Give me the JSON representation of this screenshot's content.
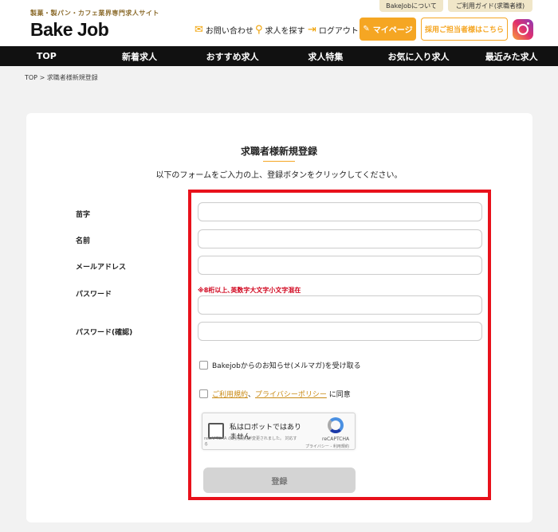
{
  "header": {
    "about_label": "BakeJobについて",
    "guide_label": "ご利用ガイド(求職者様)",
    "tagline": "製菓・製パン・カフェ業界専門求人サイト",
    "logo": "Bake Job",
    "contact_label": "お問い合わせ",
    "search_label": "求人を探す",
    "logout_label": "ログアウト",
    "mypage_label": "マイページ",
    "recruit_label": "採用ご担当者様はこちら"
  },
  "nav": {
    "items": [
      "TOP",
      "新着求人",
      "おすすめ求人",
      "求人特集",
      "お気に入り求人",
      "最近みた求人"
    ]
  },
  "breadcrumb": {
    "top": "TOP",
    "separator": ">",
    "current": "求職者様新規登録"
  },
  "form": {
    "title": "求職者様新規登録",
    "intro": "以下のフォームをご入力の上、登録ボタンをクリックしてください。",
    "fields": {
      "last_name": "苗字",
      "first_name": "名前",
      "email": "メールアドレス",
      "password": "パスワード",
      "password_confirm": "パスワード(確認)"
    },
    "password_hint": "※8桁以上､英数字大文字小文字混在",
    "newsletter_label": "Bakejobからのお知らせ(メルマガ)を受け取る",
    "terms_link": "ご利用規約",
    "terms_sep": "、",
    "privacy_link": "プライバシーポリシー",
    "agree_suffix": "に同意",
    "submit_label": "登録"
  },
  "recaptcha": {
    "label": "私はロボットではありません",
    "brand": "reCAPTCHA",
    "terms": "プライバシー - 利用規約",
    "notice": "reCAPTCHA の利用規約が変更されました。 対応する"
  }
}
